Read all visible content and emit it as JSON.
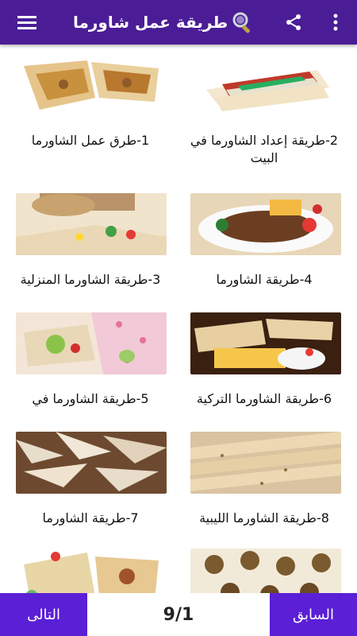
{
  "header": {
    "title": "طريقة عمل شاورما",
    "icons": [
      "menu-icon",
      "search-icon",
      "share-icon",
      "more-vert-icon"
    ]
  },
  "items": [
    {
      "label": "1-طرق عمل الشاورما"
    },
    {
      "label": "2-طريقة إعداد الشاورما في البيت"
    },
    {
      "label": "3-طريقة الشاورما المنزلية"
    },
    {
      "label": "4-طريقة الشاورما"
    },
    {
      "label": "5-طريقة الشاورما في"
    },
    {
      "label": "6-طريقة الشاورما التركية"
    },
    {
      "label": "7-طريقة الشاورما"
    },
    {
      "label": "8-طريقة الشاورما الليبية"
    },
    {
      "label": ""
    },
    {
      "label": ""
    }
  ],
  "footer": {
    "next_label": "التالى",
    "prev_label": "السابق",
    "page_indicator": "9/1"
  },
  "colors": {
    "appbar": "#4a1d96",
    "button": "#5b1fd6"
  }
}
